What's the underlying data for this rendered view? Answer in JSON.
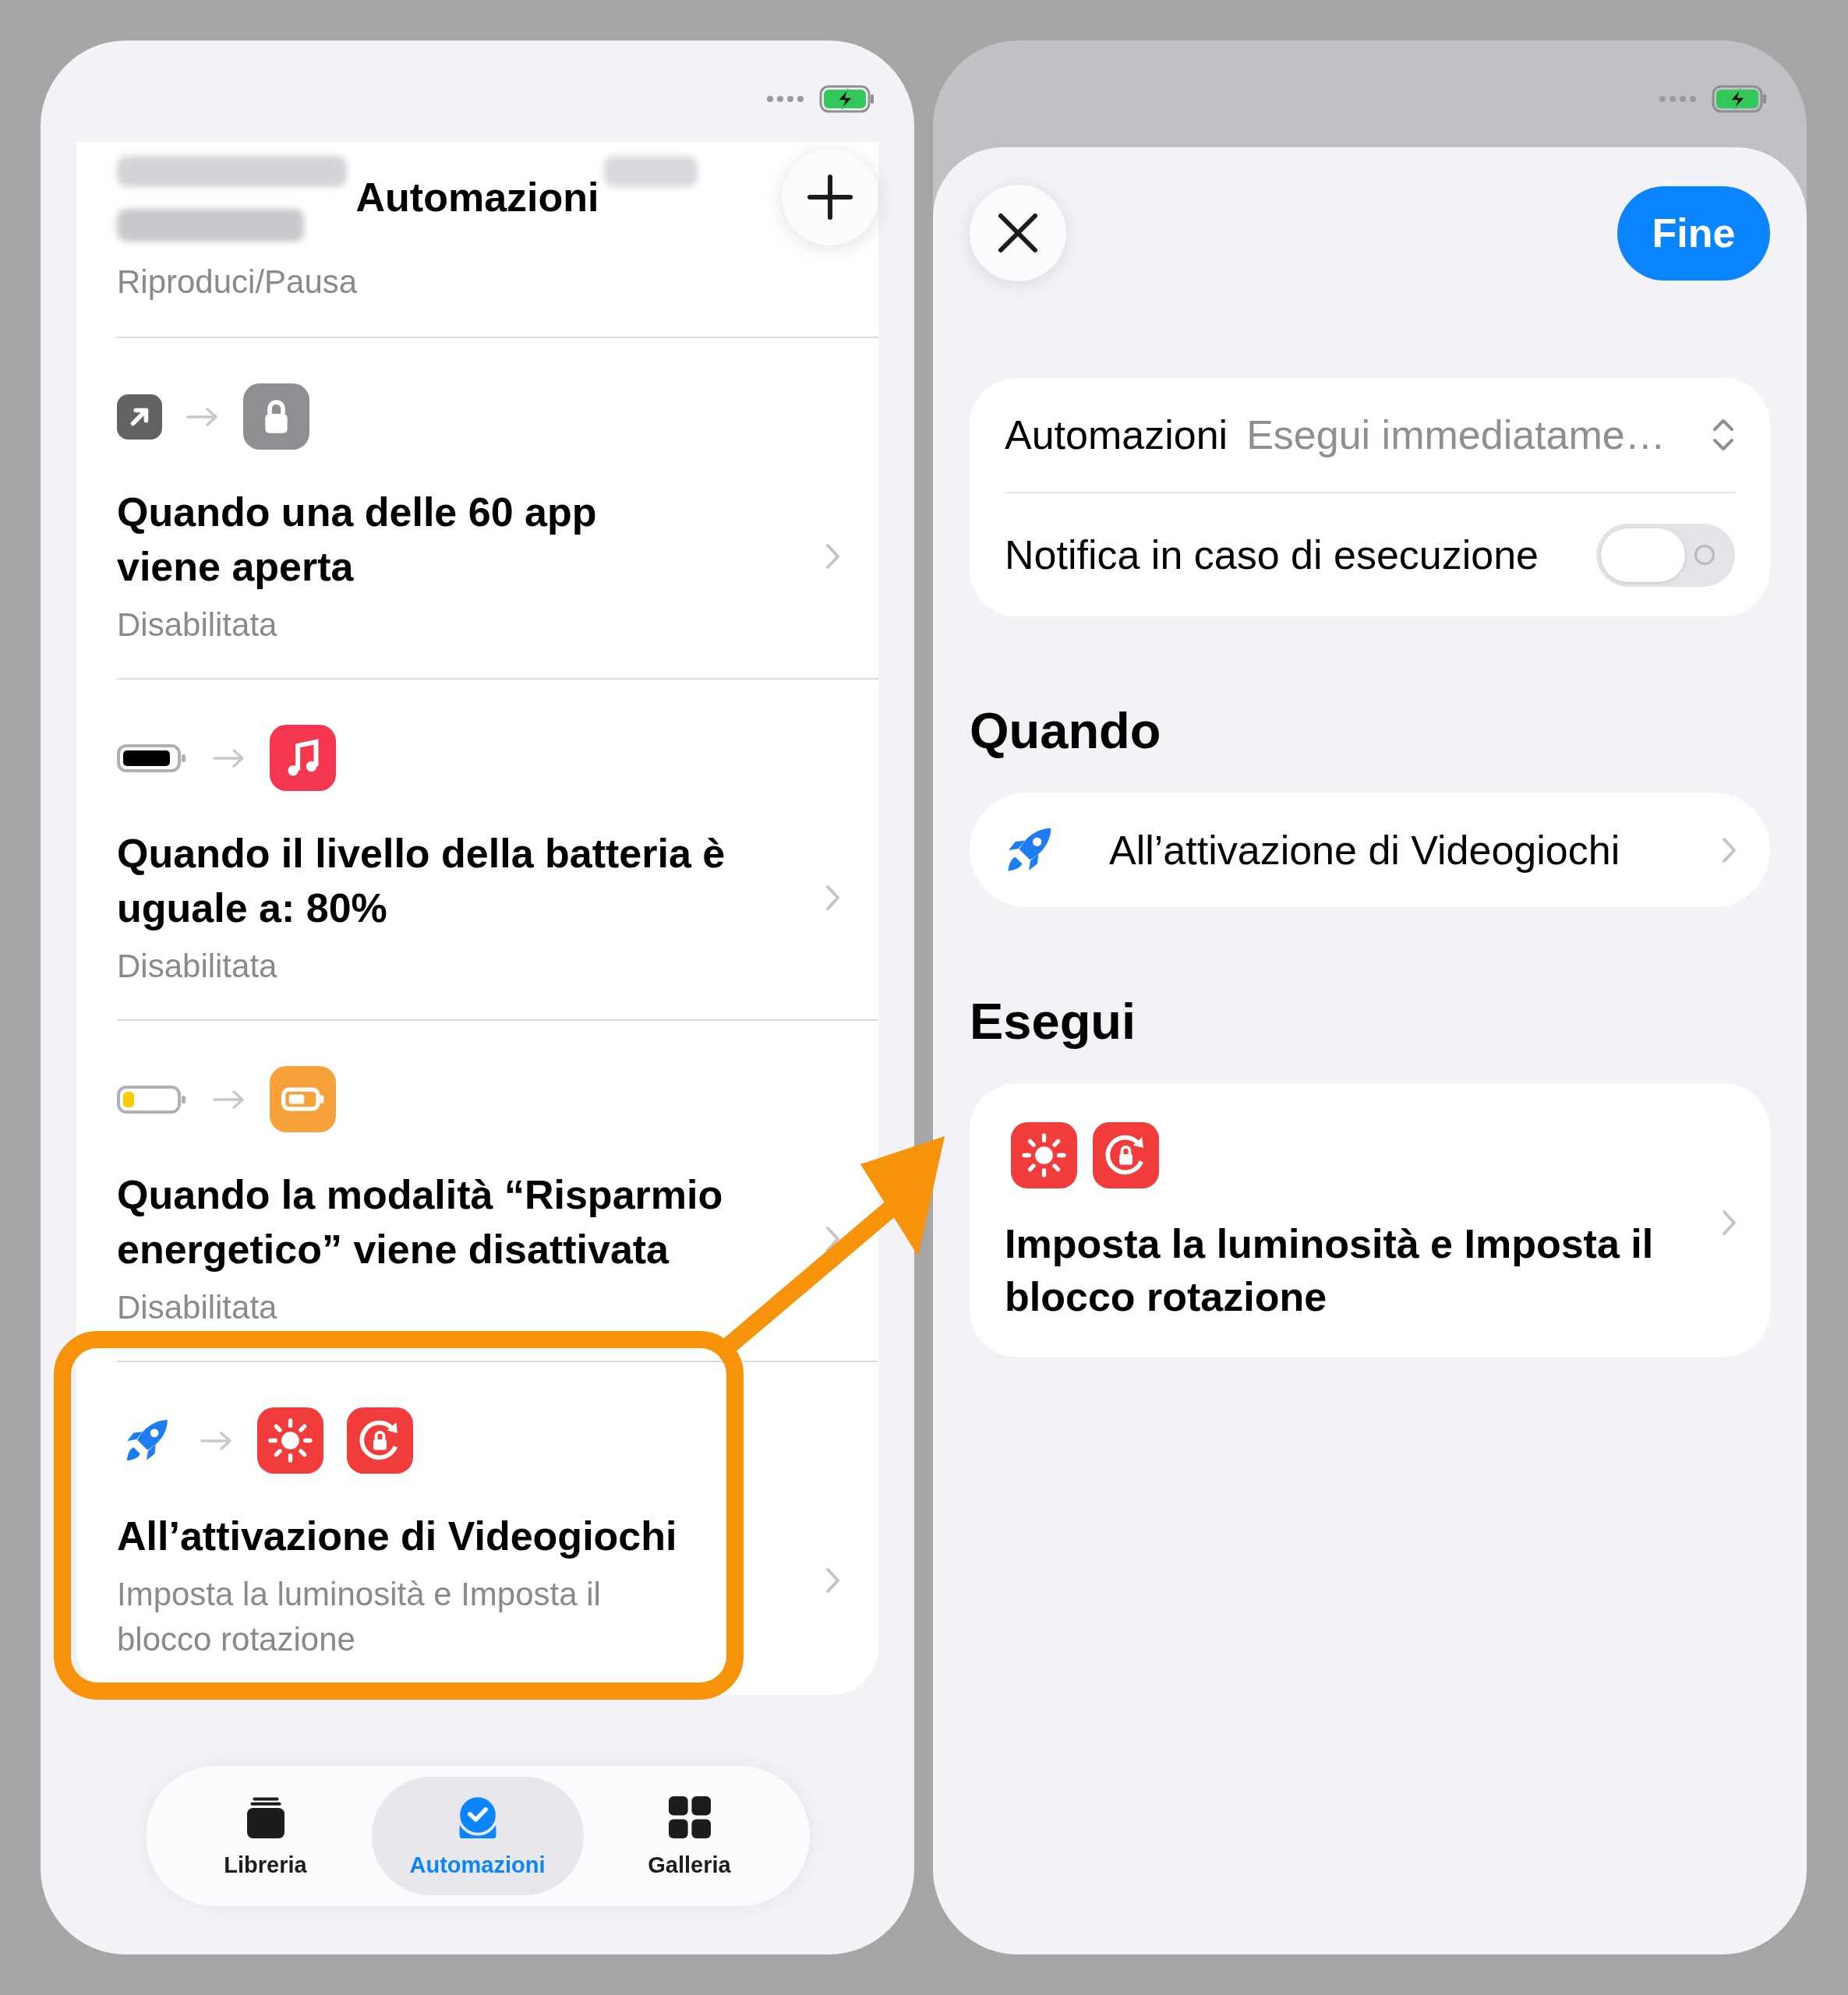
{
  "automations_screen": {
    "title": "Automazioni",
    "automations": [
      {
        "faded": true,
        "subtitle": "Riproduci/Pausa",
        "highlighted": false
      },
      {
        "faded": false,
        "trigger_icons": [
          {
            "kind": "open-app"
          }
        ],
        "action_icons": [
          {
            "kind": "lock"
          }
        ],
        "title": "Quando una delle 60 app\nviene aperta",
        "subtitle": "Disabilitata",
        "highlighted": false
      },
      {
        "faded": false,
        "trigger_icons": [
          {
            "kind": "battery-full"
          }
        ],
        "action_icons": [
          {
            "kind": "music"
          }
        ],
        "title": "Quando il livello della batteria è\nuguale a: 80%",
        "subtitle": "Disabilitata",
        "highlighted": false
      },
      {
        "faded": false,
        "trigger_icons": [
          {
            "kind": "battery-low"
          }
        ],
        "action_icons": [
          {
            "kind": "low-power"
          }
        ],
        "title": "Quando la modalità “Risparmio\nenergetico” viene disattivata",
        "subtitle": "Disabilitata",
        "highlighted": false
      },
      {
        "faded": false,
        "trigger_icons": [
          {
            "kind": "rocket"
          }
        ],
        "action_icons": [
          {
            "kind": "brightness"
          },
          {
            "kind": "rotation-lock"
          }
        ],
        "title": "All’attivazione di Videogiochi",
        "subtitle": "Imposta la luminosità e Imposta il\nblocco rotazione",
        "highlighted": true
      }
    ],
    "tab_bar": [
      {
        "kind": "library",
        "label": "Libreria",
        "selected": false
      },
      {
        "kind": "automation",
        "label": "Automazioni",
        "selected": true
      },
      {
        "kind": "gallery",
        "label": "Galleria",
        "selected": false
      }
    ]
  },
  "editor_sheet": {
    "done_button": "Fine",
    "settings": [
      {
        "kind": "picker",
        "label": "Automazioni",
        "value": "Esegui immediatame…"
      },
      {
        "kind": "toggle",
        "label": "Notifica in caso di esecuzione",
        "on": false
      }
    ],
    "sections": [
      {
        "kind": "inline",
        "heading": "Quando",
        "icons": [
          {
            "kind": "rocket"
          }
        ],
        "text": "All’attivazione di Videogiochi"
      },
      {
        "kind": "stacked",
        "heading": "Esegui",
        "icons": [
          {
            "kind": "brightness"
          },
          {
            "kind": "rotation-lock"
          }
        ],
        "text": "Imposta la luminosità e Imposta il\nblocco rotazione"
      }
    ]
  }
}
